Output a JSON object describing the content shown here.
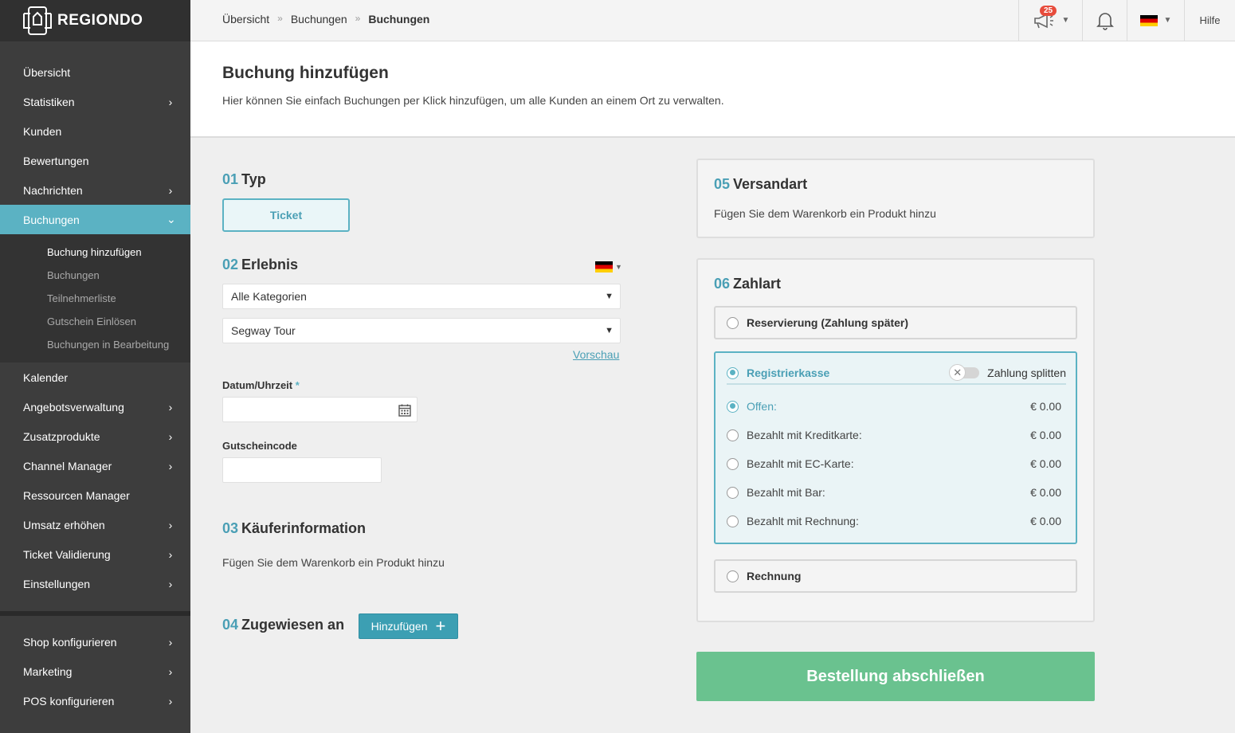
{
  "brand": {
    "name": "REGIONDO"
  },
  "sidebar": {
    "items_top": [
      {
        "label": "Übersicht",
        "chevron": false
      },
      {
        "label": "Statistiken",
        "chevron": true
      },
      {
        "label": "Kunden",
        "chevron": false
      },
      {
        "label": "Bewertungen",
        "chevron": false
      },
      {
        "label": "Nachrichten",
        "chevron": true
      },
      {
        "label": "Buchungen",
        "chevron": true,
        "active": true
      }
    ],
    "sub_items": [
      {
        "label": "Buchung hinzufügen",
        "current": true
      },
      {
        "label": "Buchungen"
      },
      {
        "label": "Teilnehmerliste"
      },
      {
        "label": "Gutschein Einlösen"
      },
      {
        "label": "Buchungen in Bearbeitung"
      }
    ],
    "items_mid": [
      {
        "label": "Kalender",
        "chevron": false
      },
      {
        "label": "Angebotsverwaltung",
        "chevron": true
      },
      {
        "label": "Zusatzprodukte",
        "chevron": true
      },
      {
        "label": "Channel Manager",
        "chevron": true
      },
      {
        "label": "Ressourcen Manager",
        "chevron": false
      },
      {
        "label": "Umsatz erhöhen",
        "chevron": true
      },
      {
        "label": "Ticket Validierung",
        "chevron": true
      },
      {
        "label": "Einstellungen",
        "chevron": true
      }
    ],
    "items_bottom": [
      {
        "label": "Shop konfigurieren",
        "chevron": true
      },
      {
        "label": "Marketing",
        "chevron": true
      },
      {
        "label": "POS konfigurieren",
        "chevron": true
      }
    ]
  },
  "topbar": {
    "breadcrumb": [
      "Übersicht",
      "Buchungen",
      "Buchungen"
    ],
    "breadcrumb_sep": "»",
    "notification_count": "25",
    "help_label": "Hilfe"
  },
  "header": {
    "title": "Buchung hinzufügen",
    "description": "Hier können Sie einfach Buchungen per Klick hinzufügen, um alle Kunden an einem Ort zu verwalten."
  },
  "form": {
    "sec1": {
      "num": "01",
      "title": "Typ",
      "ticket_label": "Ticket"
    },
    "sec2": {
      "num": "02",
      "title": "Erlebnis",
      "category_value": "Alle Kategorien",
      "product_value": "Segway Tour",
      "preview_link": "Vorschau",
      "date_label": "Datum/Uhrzeit",
      "required_mark": "*",
      "voucher_label": "Gutscheincode"
    },
    "sec3": {
      "num": "03",
      "title": "Käuferinformation",
      "hint": "Fügen Sie dem Warenkorb ein Produkt hinzu"
    },
    "sec4": {
      "num": "04",
      "title": "Zugewiesen an",
      "add_label": "Hinzufügen"
    }
  },
  "shipping": {
    "num": "05",
    "title": "Versandart",
    "hint": "Fügen Sie dem Warenkorb ein Produkt hinzu"
  },
  "payment": {
    "num": "06",
    "title": "Zahlart",
    "reservation_label": "Reservierung (Zahlung später)",
    "register_label": "Registrierkasse",
    "split_label": "Zahlung splitten",
    "rows": [
      {
        "label": "Offen:",
        "amount": "€ 0.00",
        "selected": true
      },
      {
        "label": "Bezahlt mit Kreditkarte:",
        "amount": "€ 0.00"
      },
      {
        "label": "Bezahlt mit EC-Karte:",
        "amount": "€ 0.00"
      },
      {
        "label": "Bezahlt mit Bar:",
        "amount": "€ 0.00"
      },
      {
        "label": "Bezahlt mit Rechnung:",
        "amount": "€ 0.00"
      }
    ],
    "invoice_label": "Rechnung"
  },
  "order_button": "Bestellung abschließen",
  "colors": {
    "accent": "#5bb2c3",
    "order": "#6ac28f",
    "sidebar": "#3d3d3d"
  }
}
